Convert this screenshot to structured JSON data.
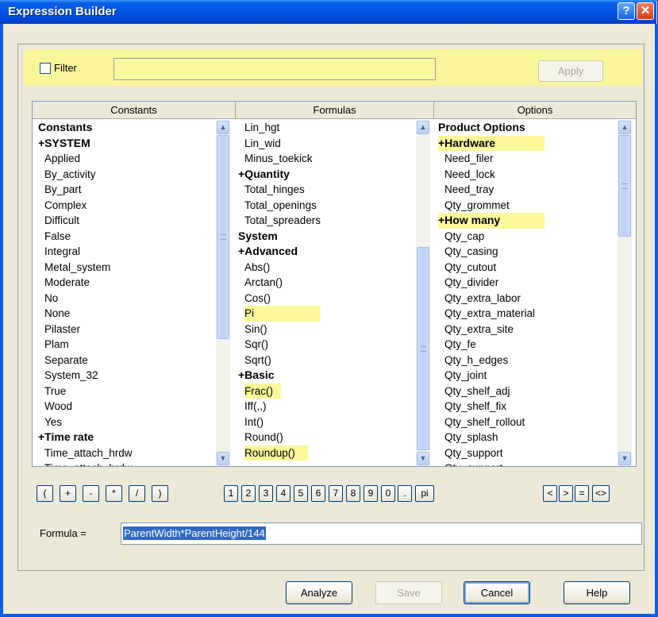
{
  "window": {
    "title": "Expression Builder",
    "help_glyph": "?",
    "close_glyph": "✕"
  },
  "filter": {
    "label": "Filter",
    "value": "",
    "apply_label": "Apply",
    "highlight_color": "#f8f59a"
  },
  "columns": [
    {
      "header": "Constants",
      "items": [
        {
          "text": "Constants",
          "group": true
        },
        {
          "text": "+SYSTEM",
          "group": true
        },
        {
          "text": "Applied"
        },
        {
          "text": "By_activity"
        },
        {
          "text": "By_part"
        },
        {
          "text": "Complex"
        },
        {
          "text": "Difficult"
        },
        {
          "text": "False"
        },
        {
          "text": "Integral"
        },
        {
          "text": "Metal_system"
        },
        {
          "text": "Moderate"
        },
        {
          "text": "No"
        },
        {
          "text": "None"
        },
        {
          "text": "Pilaster"
        },
        {
          "text": "Plam"
        },
        {
          "text": "Separate"
        },
        {
          "text": "System_32"
        },
        {
          "text": "True"
        },
        {
          "text": "Wood"
        },
        {
          "text": "Yes"
        },
        {
          "text": "+Time rate",
          "group": true
        },
        {
          "text": "Time_attach_hrdw"
        },
        {
          "text": "Time_attach_hrdw"
        }
      ]
    },
    {
      "header": "Formulas",
      "items": [
        {
          "text": "Lin_hgt"
        },
        {
          "text": "Lin_wid"
        },
        {
          "text": "Minus_toekick"
        },
        {
          "text": "+Quantity",
          "group": true
        },
        {
          "text": "Total_hinges"
        },
        {
          "text": "Total_openings"
        },
        {
          "text": "Total_spreaders"
        },
        {
          "text": "System",
          "group": true
        },
        {
          "text": "+Advanced",
          "group": true
        },
        {
          "text": "Abs()"
        },
        {
          "text": "Arctan()"
        },
        {
          "text": "Cos()"
        },
        {
          "text": "Pi",
          "highlight": true,
          "hl_width": 95
        },
        {
          "text": "Sin()"
        },
        {
          "text": "Sqr()"
        },
        {
          "text": "Sqrt()"
        },
        {
          "text": "+Basic",
          "group": true
        },
        {
          "text": "Frac()",
          "highlight": true,
          "hl_width": 46
        },
        {
          "text": "Iff(,,)"
        },
        {
          "text": "Int()"
        },
        {
          "text": "Round()"
        },
        {
          "text": "Roundup()",
          "highlight": true,
          "hl_width": 80
        }
      ]
    },
    {
      "header": "Options",
      "items": [
        {
          "text": "Product Options",
          "group": true
        },
        {
          "text": "+Hardware",
          "group": true,
          "highlight": true,
          "hl_width": 134
        },
        {
          "text": "Need_filer"
        },
        {
          "text": "Need_lock"
        },
        {
          "text": "Need_tray"
        },
        {
          "text": "Qty_grommet"
        },
        {
          "text": "+How many",
          "group": true,
          "highlight": true,
          "hl_width": 134
        },
        {
          "text": "Qty_cap"
        },
        {
          "text": "Qty_casing"
        },
        {
          "text": "Qty_cutout"
        },
        {
          "text": "Qty_divider"
        },
        {
          "text": "Qty_extra_labor"
        },
        {
          "text": "Qty_extra_material"
        },
        {
          "text": "Qty_extra_site"
        },
        {
          "text": "Qty_fe"
        },
        {
          "text": "Qty_h_edges"
        },
        {
          "text": "Qty_joint"
        },
        {
          "text": "Qty_shelf_adj"
        },
        {
          "text": "Qty_shelf_fix"
        },
        {
          "text": "Qty_shelf_rollout"
        },
        {
          "text": "Qty_splash"
        },
        {
          "text": "Qty_support"
        },
        {
          "text": "Qty_support"
        }
      ]
    }
  ],
  "keypad": {
    "operators": [
      "(",
      "+",
      "-",
      "*",
      "/",
      ")"
    ],
    "digits": [
      "1",
      "2",
      "3",
      "4",
      "5",
      "6",
      "7",
      "8",
      "9",
      "0",
      ".",
      "pi"
    ],
    "comparators": [
      "<",
      ">",
      "=",
      "<>"
    ]
  },
  "formula": {
    "label": "Formula =",
    "value": "ParentWidth*ParentHeight/144"
  },
  "buttons": {
    "analyze": "Analyze",
    "save": "Save",
    "cancel": "Cancel",
    "help": "Help"
  }
}
